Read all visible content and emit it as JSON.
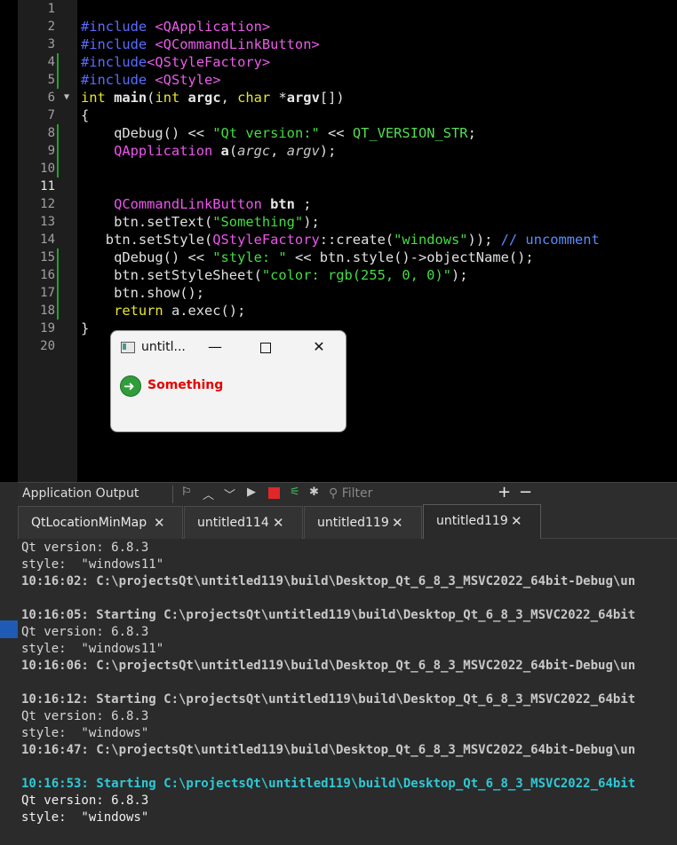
{
  "editor": {
    "line_numbers": [
      "1",
      "2",
      "3",
      "4",
      "5",
      "6",
      "7",
      "8",
      "9",
      "10",
      "11",
      "12",
      "13",
      "14",
      "15",
      "16",
      "17",
      "18",
      "19",
      "20"
    ],
    "current_line": "11",
    "fold_marker": "▼",
    "lines": {
      "l2": {
        "a": "#include",
        "b": " <QApplication>"
      },
      "l3": {
        "a": "#include",
        "b": " <QCommandLinkButton>"
      },
      "l4": {
        "a": "#include",
        "b": "<QStyleFactory>"
      },
      "l5": {
        "a": "#include",
        "b": " <QStyle>"
      },
      "l6": {
        "a": "int",
        "b": " main",
        "c": "(",
        "d": "int",
        "e": " argc",
        "f": ", ",
        "g": "char",
        "h": " *",
        "i": "argv",
        "j": "[])"
      },
      "l7": {
        "a": "{"
      },
      "l8": {
        "a": "    qDebug",
        "b": "() << ",
        "c": "\"Qt version:\"",
        "d": " << ",
        "e": "QT_VERSION_STR",
        "f": ";"
      },
      "l9": {
        "a": "    QApplication",
        "b": " a",
        "c": "(",
        "d": "argc",
        "e": ", ",
        "f": "argv",
        "g": ");"
      },
      "l12": {
        "a": "    QCommandLinkButton",
        "b": " btn",
        "c": " ;"
      },
      "l13": {
        "a": "    btn.setText(",
        "b": "\"Something\"",
        "c": ");"
      },
      "l14": {
        "a": "   btn.setStyle(",
        "b": "QStyleFactory",
        "c": "::create(",
        "d": "\"windows\"",
        "e": ")); ",
        "f": "// uncomment"
      },
      "l15": {
        "a": "    qDebug",
        "b": "() << ",
        "c": "\"style: \"",
        "d": " << btn.style()->objectName();"
      },
      "l16": {
        "a": "    btn.setStyleSheet(",
        "b": "\"color: rgb(255, 0, 0)\"",
        "c": ");"
      },
      "l17": {
        "a": "    btn.show();"
      },
      "l18": {
        "a": "    return",
        "b": " a.exec();"
      },
      "l19": {
        "a": "}"
      }
    }
  },
  "window": {
    "title": "untitl...",
    "minimize_glyph": "—",
    "close_glyph": "✕",
    "button_text": "Something"
  },
  "output": {
    "title": "Application Output",
    "toolbar_glyphs": {
      "attach": "⚐",
      "up": "︿",
      "down": "﹀",
      "run": "▶",
      "debug": "⚟",
      "settings": "✱",
      "search": "⚲",
      "plus": "+",
      "minus": "−"
    },
    "filter_placeholder": "Filter",
    "tabs": [
      {
        "label": "QtLocationMinMap",
        "close": "✕"
      },
      {
        "label": "untitled114",
        "close": "✕"
      },
      {
        "label": "untitled119",
        "close": "✕"
      },
      {
        "label": "untitled119",
        "close": "✕"
      }
    ],
    "lines": [
      "Qt version: 6.8.3",
      "style:  \"windows11\"",
      "10:16:02: C:\\projectsQt\\untitled119\\build\\Desktop_Qt_6_8_3_MSVC2022_64bit-Debug\\un",
      "",
      "10:16:05: Starting C:\\projectsQt\\untitled119\\build\\Desktop_Qt_6_8_3_MSVC2022_64bit",
      "Qt version: 6.8.3",
      "style:  \"windows11\"",
      "10:16:06: C:\\projectsQt\\untitled119\\build\\Desktop_Qt_6_8_3_MSVC2022_64bit-Debug\\un",
      "",
      "10:16:12: Starting C:\\projectsQt\\untitled119\\build\\Desktop_Qt_6_8_3_MSVC2022_64bit",
      "Qt version: 6.8.3",
      "style:  \"windows\"",
      "10:16:47: C:\\projectsQt\\untitled119\\build\\Desktop_Qt_6_8_3_MSVC2022_64bit-Debug\\un",
      "",
      "10:16:53: Starting C:\\projectsQt\\untitled119\\build\\Desktop_Qt_6_8_3_MSVC2022_64bit",
      "Qt version: 6.8.3",
      "style:  \"windows\""
    ]
  }
}
